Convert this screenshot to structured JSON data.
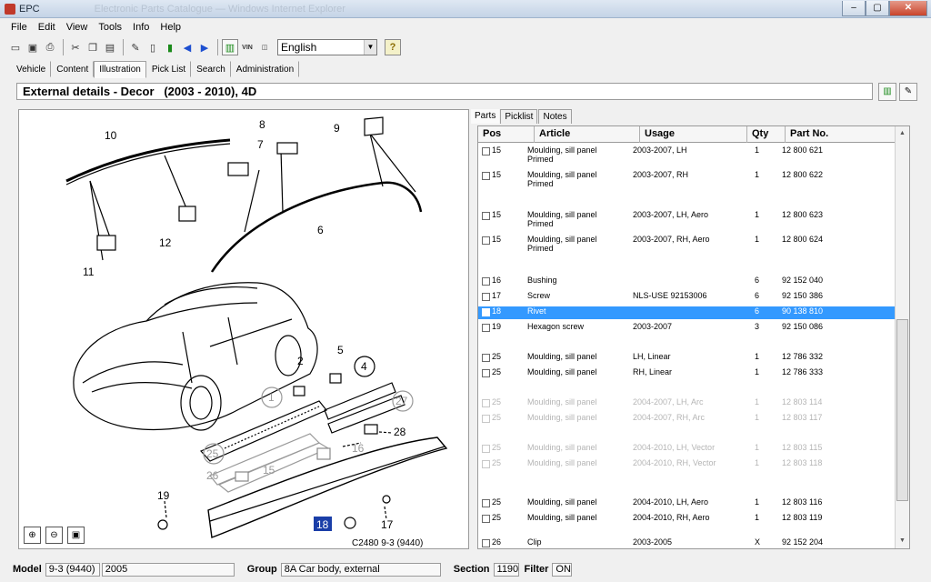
{
  "window": {
    "title": "EPC",
    "title_blurred": "Electronic Parts Catalogue — Windows Internet Explorer",
    "minimize": "–",
    "maximize": "▢",
    "close": "✕"
  },
  "menu": [
    "File",
    "Edit",
    "View",
    "Tools",
    "Info",
    "Help"
  ],
  "toolbar": {
    "language": "English",
    "vin_label": "VIN",
    "help_label": "?"
  },
  "tabs": [
    "Vehicle",
    "Content",
    "Illustration",
    "Pick List",
    "Search",
    "Administration"
  ],
  "active_tab": "Illustration",
  "page_title": "External details - Decor   (2003 - 2010), 4D",
  "illustration": {
    "caption": "C2480 9-3 (9440)",
    "callouts": [
      "10",
      "8",
      "9",
      "7",
      "6",
      "12",
      "11",
      "5",
      "2",
      "4",
      "1",
      "27",
      "28",
      "16",
      "25",
      "26",
      "15",
      "19",
      "18",
      "17"
    ]
  },
  "parts_tabs": [
    "Parts",
    "Picklist",
    "Notes"
  ],
  "parts": {
    "columns": [
      "Pos",
      "Article",
      "Usage",
      "Qty",
      "Part No."
    ],
    "rows": [
      {
        "pos": "15",
        "article": "Moulding, sill panel\nPrimed",
        "usage": "2003-2007, LH",
        "qty": "1",
        "part": "12 800 621",
        "state": "normal"
      },
      {
        "pos": "15",
        "article": "Moulding, sill panel\nPrimed",
        "usage": "2003-2007, RH",
        "qty": "1",
        "part": "12 800 622",
        "state": "normal"
      },
      {
        "pos": "15",
        "article": "Moulding, sill panel\nPrimed",
        "usage": "2003-2007, LH, Aero",
        "qty": "1",
        "part": "12 800 623",
        "state": "normal"
      },
      {
        "pos": "15",
        "article": "Moulding, sill panel\nPrimed",
        "usage": "2003-2007, RH, Aero",
        "qty": "1",
        "part": "12 800 624",
        "state": "normal"
      },
      {
        "pos": "16",
        "article": "Bushing",
        "usage": "",
        "qty": "6",
        "part": "92 152 040",
        "state": "normal"
      },
      {
        "pos": "17",
        "article": "Screw",
        "usage": "NLS-USE 92153006",
        "qty": "6",
        "part": "92 150 386",
        "state": "normal"
      },
      {
        "pos": "18",
        "article": "Rivet",
        "usage": "",
        "qty": "6",
        "part": "90 138 810",
        "state": "selected"
      },
      {
        "pos": "19",
        "article": "Hexagon screw",
        "usage": "2003-2007",
        "qty": "3",
        "part": "92 150 086",
        "state": "normal"
      },
      {
        "pos": "25",
        "article": "Moulding, sill panel",
        "usage": "LH, Linear",
        "qty": "1",
        "part": "12 786 332",
        "state": "normal"
      },
      {
        "pos": "25",
        "article": "Moulding, sill panel",
        "usage": "RH, Linear",
        "qty": "1",
        "part": "12 786 333",
        "state": "normal"
      },
      {
        "pos": "25",
        "article": "Moulding, sill panel",
        "usage": "2004-2007, LH, Arc",
        "qty": "1",
        "part": "12 803 114",
        "state": "faded"
      },
      {
        "pos": "25",
        "article": "Moulding, sill panel",
        "usage": "2004-2007, RH, Arc",
        "qty": "1",
        "part": "12 803 117",
        "state": "faded"
      },
      {
        "pos": "25",
        "article": "Moulding, sill panel",
        "usage": "2004-2010, LH, Vector",
        "qty": "1",
        "part": "12 803 115",
        "state": "faded"
      },
      {
        "pos": "25",
        "article": "Moulding, sill panel",
        "usage": "2004-2010, RH, Vector",
        "qty": "1",
        "part": "12 803 118",
        "state": "faded"
      },
      {
        "pos": "25",
        "article": "Moulding, sill panel",
        "usage": "2004-2010, LH, Aero",
        "qty": "1",
        "part": "12 803 116",
        "state": "normal"
      },
      {
        "pos": "25",
        "article": "Moulding, sill panel",
        "usage": "2004-2010, RH, Aero",
        "qty": "1",
        "part": "12 803 119",
        "state": "normal"
      },
      {
        "pos": "26",
        "article": "Clip",
        "usage": "2003-2005",
        "qty": "X",
        "part": "92 152 204",
        "state": "normal"
      }
    ]
  },
  "status": {
    "model_label": "Model",
    "model": "9-3 (9440)",
    "year": "2005",
    "group_label": "Group",
    "group": "8A Car body, external",
    "section_label": "Section",
    "section": "1190",
    "filter_label": "Filter",
    "filter": "ON"
  },
  "colors": {
    "selection": "#3399ff",
    "callout_highlight": "#1a3ea8"
  }
}
